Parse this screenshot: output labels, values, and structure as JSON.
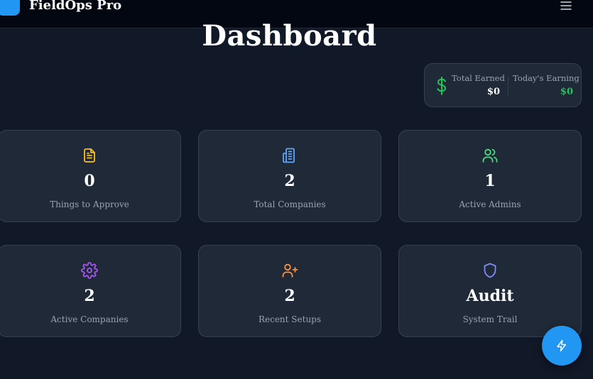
{
  "app": {
    "title": "FieldOps Pro"
  },
  "header": {
    "menu_icon": "hamburger-menu-icon"
  },
  "page": {
    "title": "Dashboard"
  },
  "earnings": {
    "total_label": "Total Earned",
    "total_value": "$0",
    "today_label": "Today's Earning",
    "today_value": "$0",
    "icon": "dollar-icon",
    "accent_color": "#22c55e"
  },
  "stats": [
    {
      "value": "0",
      "label": "Things to Approve",
      "icon": "document-icon",
      "color": "#fbbf24"
    },
    {
      "value": "2",
      "label": "Total Companies",
      "icon": "building-icon",
      "color": "#60a5fa"
    },
    {
      "value": "1",
      "label": "Active Admins",
      "icon": "users-icon",
      "color": "#4ade80"
    },
    {
      "value": "2",
      "label": "Active Companies",
      "icon": "gear-icon",
      "color": "#a855f7"
    },
    {
      "value": "2",
      "label": "Recent Setups",
      "icon": "user-plus-icon",
      "color": "#fb923c"
    },
    {
      "value": "Audit",
      "label": "System Trail",
      "icon": "shield-icon",
      "color": "#818cf8"
    }
  ],
  "fab": {
    "icon": "lightning-icon",
    "color": "#2196f3"
  }
}
